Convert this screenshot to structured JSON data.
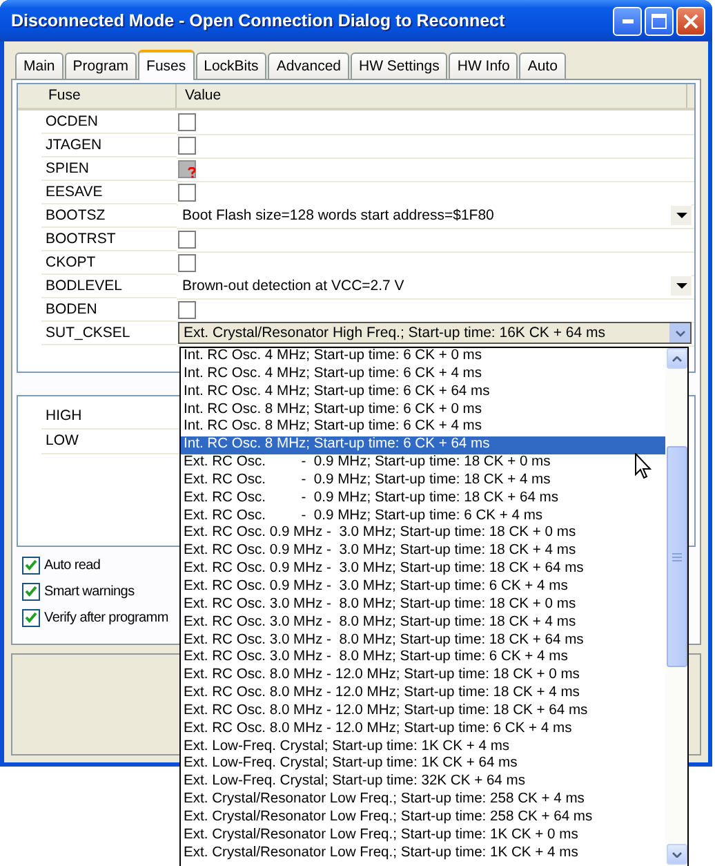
{
  "window": {
    "title": "Disconnected Mode - Open Connection Dialog to Reconnect"
  },
  "tabs": [
    {
      "label": "Main",
      "selected": false
    },
    {
      "label": "Program",
      "selected": false
    },
    {
      "label": "Fuses",
      "selected": true
    },
    {
      "label": "LockBits",
      "selected": false
    },
    {
      "label": "Advanced",
      "selected": false
    },
    {
      "label": "HW Settings",
      "selected": false
    },
    {
      "label": "HW Info",
      "selected": false
    },
    {
      "label": "Auto",
      "selected": false
    }
  ],
  "fuse_table": {
    "columns": [
      "Fuse",
      "Value"
    ],
    "rows": [
      {
        "name": "OCDEN",
        "kind": "checkbox",
        "checked": false,
        "indeterminate": false
      },
      {
        "name": "JTAGEN",
        "kind": "checkbox",
        "checked": false,
        "indeterminate": false
      },
      {
        "name": "SPIEN",
        "kind": "checkbox",
        "checked": false,
        "indeterminate": true
      },
      {
        "name": "EESAVE",
        "kind": "checkbox",
        "checked": false,
        "indeterminate": false
      },
      {
        "name": "BOOTSZ",
        "kind": "combo",
        "value": "Boot Flash size=128 words start address=$1F80",
        "open": false
      },
      {
        "name": "BOOTRST",
        "kind": "checkbox",
        "checked": false,
        "indeterminate": false
      },
      {
        "name": "CKOPT",
        "kind": "checkbox",
        "checked": false,
        "indeterminate": false
      },
      {
        "name": "BODLEVEL",
        "kind": "combo",
        "value": "Brown-out detection at VCC=2.7 V",
        "open": false
      },
      {
        "name": "BODEN",
        "kind": "checkbox",
        "checked": false,
        "indeterminate": false
      },
      {
        "name": "SUT_CKSEL",
        "kind": "combo",
        "value": "Ext. Crystal/Resonator High Freq.; Start-up time: 16K CK + 64 ms",
        "open": true
      }
    ]
  },
  "fuse_bytes": [
    "HIGH",
    "LOW"
  ],
  "options": [
    {
      "label": "Auto read",
      "checked": true
    },
    {
      "label": "Smart warnings",
      "checked": true
    },
    {
      "label": "Verify after programm",
      "checked": true
    }
  ],
  "dropdown": {
    "items": [
      {
        "label": "Int. RC Osc. 4 MHz; Start-up time: 6 CK + 0 ms",
        "selected": false
      },
      {
        "label": "Int. RC Osc. 4 MHz; Start-up time: 6 CK + 4 ms",
        "selected": false
      },
      {
        "label": "Int. RC Osc. 4 MHz; Start-up time: 6 CK + 64 ms",
        "selected": false
      },
      {
        "label": "Int. RC Osc. 8 MHz; Start-up time: 6 CK + 0 ms",
        "selected": false
      },
      {
        "label": "Int. RC Osc. 8 MHz; Start-up time: 6 CK + 4 ms",
        "selected": false
      },
      {
        "label": "Int. RC Osc. 8 MHz; Start-up time: 6 CK + 64 ms",
        "selected": true
      },
      {
        "label": "Ext. RC Osc.         -  0.9 MHz; Start-up time: 18 CK + 0 ms",
        "selected": false
      },
      {
        "label": "Ext. RC Osc.         -  0.9 MHz; Start-up time: 18 CK + 4 ms",
        "selected": false
      },
      {
        "label": "Ext. RC Osc.         -  0.9 MHz; Start-up time: 18 CK + 64 ms",
        "selected": false
      },
      {
        "label": "Ext. RC Osc.         -  0.9 MHz; Start-up time: 6 CK + 4 ms",
        "selected": false
      },
      {
        "label": "Ext. RC Osc. 0.9 MHz -  3.0 MHz; Start-up time: 18 CK + 0 ms",
        "selected": false
      },
      {
        "label": "Ext. RC Osc. 0.9 MHz -  3.0 MHz; Start-up time: 18 CK + 4 ms",
        "selected": false
      },
      {
        "label": "Ext. RC Osc. 0.9 MHz -  3.0 MHz; Start-up time: 18 CK + 64 ms",
        "selected": false
      },
      {
        "label": "Ext. RC Osc. 0.9 MHz -  3.0 MHz; Start-up time: 6 CK + 4 ms",
        "selected": false
      },
      {
        "label": "Ext. RC Osc. 3.0 MHz -  8.0 MHz; Start-up time: 18 CK + 0 ms",
        "selected": false
      },
      {
        "label": "Ext. RC Osc. 3.0 MHz -  8.0 MHz; Start-up time: 18 CK + 4 ms",
        "selected": false
      },
      {
        "label": "Ext. RC Osc. 3.0 MHz -  8.0 MHz; Start-up time: 18 CK + 64 ms",
        "selected": false
      },
      {
        "label": "Ext. RC Osc. 3.0 MHz -  8.0 MHz; Start-up time: 6 CK + 4 ms",
        "selected": false
      },
      {
        "label": "Ext. RC Osc. 8.0 MHz - 12.0 MHz; Start-up time: 18 CK + 0 ms",
        "selected": false
      },
      {
        "label": "Ext. RC Osc. 8.0 MHz - 12.0 MHz; Start-up time: 18 CK + 4 ms",
        "selected": false
      },
      {
        "label": "Ext. RC Osc. 8.0 MHz - 12.0 MHz; Start-up time: 18 CK + 64 ms",
        "selected": false
      },
      {
        "label": "Ext. RC Osc. 8.0 MHz - 12.0 MHz; Start-up time: 6 CK + 4 ms",
        "selected": false
      },
      {
        "label": "Ext. Low-Freq. Crystal; Start-up time: 1K CK + 4 ms",
        "selected": false
      },
      {
        "label": "Ext. Low-Freq. Crystal; Start-up time: 1K CK + 64 ms",
        "selected": false
      },
      {
        "label": "Ext. Low-Freq. Crystal; Start-up time: 32K CK + 64 ms",
        "selected": false
      },
      {
        "label": "Ext. Crystal/Resonator Low Freq.; Start-up time: 258 CK + 4 ms",
        "selected": false
      },
      {
        "label": "Ext. Crystal/Resonator Low Freq.; Start-up time: 258 CK + 64 ms",
        "selected": false
      },
      {
        "label": "Ext. Crystal/Resonator Low Freq.; Start-up time: 1K CK + 0 ms",
        "selected": false
      },
      {
        "label": "Ext. Crystal/Resonator Low Freq.; Start-up time: 1K CK + 4 ms",
        "selected": false
      }
    ]
  }
}
